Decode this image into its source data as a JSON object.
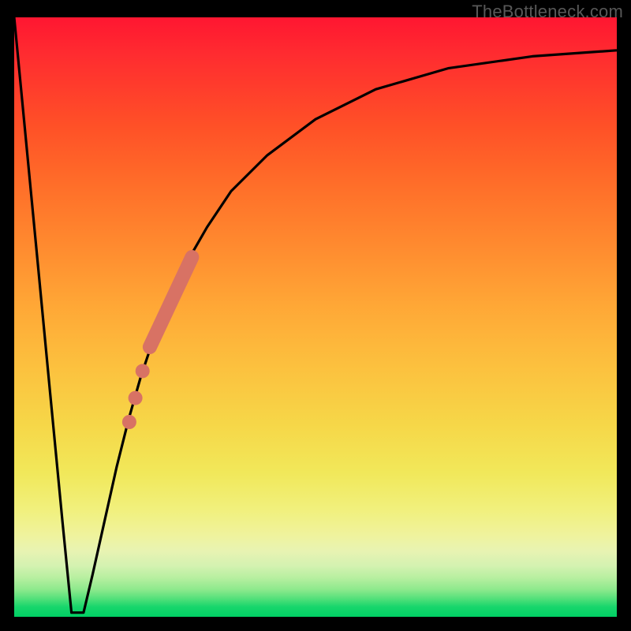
{
  "watermark": "TheBottleneck.com",
  "colors": {
    "frame": "#000000",
    "curve": "#000000",
    "dot": "#d87264",
    "gradient_top": "#ff1631",
    "gradient_bottom": "#00d064"
  },
  "chart_data": {
    "type": "line",
    "title": "",
    "xlabel": "",
    "ylabel": "",
    "xlim": [
      0,
      100
    ],
    "ylim": [
      0,
      100
    ],
    "grid": false,
    "legend": false,
    "series": [
      {
        "name": "left-descent",
        "x": [
          0,
          2,
          4,
          6,
          8,
          9.5
        ],
        "values": [
          100,
          79,
          58,
          37,
          16,
          0.7
        ]
      },
      {
        "name": "valley-floor",
        "x": [
          9.5,
          11.5
        ],
        "values": [
          0.7,
          0.7
        ]
      },
      {
        "name": "right-ascent",
        "x": [
          11.5,
          13,
          15,
          17,
          19,
          21,
          23,
          25,
          28,
          32,
          36,
          42,
          50,
          60,
          72,
          86,
          100
        ],
        "values": [
          0.7,
          7,
          16,
          25,
          33,
          40,
          46,
          51,
          58,
          65,
          71,
          77,
          83,
          88,
          91.5,
          93.5,
          94.5
        ]
      },
      {
        "name": "salmon-band",
        "style": "thick",
        "x": [
          22.5,
          29.5
        ],
        "values": [
          45,
          60
        ]
      }
    ],
    "points": [
      {
        "name": "salmon-dot-1",
        "x": 21.3,
        "y": 41
      },
      {
        "name": "salmon-dot-2",
        "x": 20.1,
        "y": 36.5
      },
      {
        "name": "salmon-dot-3",
        "x": 19.1,
        "y": 32.5
      }
    ]
  }
}
